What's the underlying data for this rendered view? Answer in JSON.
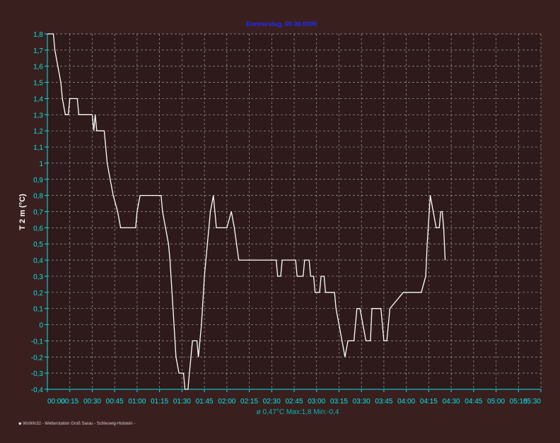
{
  "chart_data": {
    "type": "line",
    "title": "Donnerstag, 00.00.0000",
    "ylabel": "T 2 m (°C)",
    "xlabel": "",
    "ylim": [
      -0.4,
      1.8
    ],
    "grid": true,
    "x_ticks": [
      "00:00",
      "00:15",
      "00:30",
      "00:45",
      "01:00",
      "01:15",
      "01:30",
      "01:45",
      "02:00",
      "02:15",
      "02:30",
      "02:45",
      "03:00",
      "03:15",
      "03:30",
      "03:45",
      "04:00",
      "04:15",
      "04:30",
      "04:45",
      "05:00",
      "05:15",
      "05:30"
    ],
    "y_ticks": [
      "1,8",
      "1,7",
      "1,6",
      "1,5",
      "1,4",
      "1,3",
      "1,2",
      "1,1",
      "1",
      "0,9",
      "0,8",
      "0,7",
      "0,6",
      "0,5",
      "0,4",
      "0,3",
      "0,2",
      "0,1",
      "0",
      "-0,1",
      "-0,2",
      "-0,3",
      "-0,4"
    ],
    "series": [
      {
        "color": "#ffffff",
        "points": [
          [
            "00:00",
            1.8
          ],
          [
            "00:04",
            1.8
          ],
          [
            "00:05",
            1.7
          ],
          [
            "00:07",
            1.6
          ],
          [
            "00:09",
            1.5
          ],
          [
            "00:10",
            1.4
          ],
          [
            "00:12",
            1.3
          ],
          [
            "00:14",
            1.3
          ],
          [
            "00:15",
            1.4
          ],
          [
            "00:20",
            1.4
          ],
          [
            "00:21",
            1.3
          ],
          [
            "00:30",
            1.3
          ],
          [
            "00:31",
            1.2
          ],
          [
            "00:32",
            1.3
          ],
          [
            "00:33",
            1.2
          ],
          [
            "00:38",
            1.2
          ],
          [
            "00:39",
            1.1
          ],
          [
            "00:40",
            1.0
          ],
          [
            "00:42",
            0.9
          ],
          [
            "00:44",
            0.8
          ],
          [
            "00:47",
            0.7
          ],
          [
            "00:49",
            0.6
          ],
          [
            "00:59",
            0.6
          ],
          [
            "01:00",
            0.7
          ],
          [
            "01:02",
            0.8
          ],
          [
            "01:16",
            0.8
          ],
          [
            "01:17",
            0.7
          ],
          [
            "01:19",
            0.6
          ],
          [
            "01:21",
            0.5
          ],
          [
            "01:22",
            0.4
          ],
          [
            "01:24",
            0.1
          ],
          [
            "01:26",
            -0.2
          ],
          [
            "01:28",
            -0.3
          ],
          [
            "01:31",
            -0.3
          ],
          [
            "01:32",
            -0.4
          ],
          [
            "01:34",
            -0.4
          ],
          [
            "01:35",
            -0.3
          ],
          [
            "01:37",
            -0.1
          ],
          [
            "01:40",
            -0.1
          ],
          [
            "01:41",
            -0.2
          ],
          [
            "01:43",
            0.0
          ],
          [
            "01:45",
            0.3
          ],
          [
            "01:47",
            0.5
          ],
          [
            "01:49",
            0.7
          ],
          [
            "01:51",
            0.8
          ],
          [
            "01:53",
            0.6
          ],
          [
            "02:00",
            0.6
          ],
          [
            "02:03",
            0.7
          ],
          [
            "02:05",
            0.6
          ],
          [
            "02:08",
            0.4
          ],
          [
            "02:33",
            0.4
          ],
          [
            "02:34",
            0.3
          ],
          [
            "02:36",
            0.3
          ],
          [
            "02:37",
            0.4
          ],
          [
            "02:46",
            0.4
          ],
          [
            "02:47",
            0.3
          ],
          [
            "02:51",
            0.3
          ],
          [
            "02:52",
            0.4
          ],
          [
            "02:55",
            0.4
          ],
          [
            "02:56",
            0.3
          ],
          [
            "02:58",
            0.3
          ],
          [
            "02:59",
            0.2
          ],
          [
            "03:02",
            0.2
          ],
          [
            "03:03",
            0.3
          ],
          [
            "03:05",
            0.3
          ],
          [
            "03:06",
            0.2
          ],
          [
            "03:12",
            0.2
          ],
          [
            "03:13",
            0.1
          ],
          [
            "03:15",
            0.0
          ],
          [
            "03:17",
            -0.1
          ],
          [
            "03:19",
            -0.2
          ],
          [
            "03:21",
            -0.1
          ],
          [
            "03:25",
            -0.1
          ],
          [
            "03:27",
            0.1
          ],
          [
            "03:29",
            0.1
          ],
          [
            "03:31",
            0.0
          ],
          [
            "03:33",
            -0.1
          ],
          [
            "03:36",
            -0.1
          ],
          [
            "03:37",
            0.1
          ],
          [
            "03:43",
            0.1
          ],
          [
            "03:45",
            -0.1
          ],
          [
            "03:47",
            -0.1
          ],
          [
            "03:49",
            0.1
          ],
          [
            "03:58",
            0.2
          ],
          [
            "04:10",
            0.2
          ],
          [
            "04:13",
            0.3
          ],
          [
            "04:14",
            0.5
          ],
          [
            "04:16",
            0.8
          ],
          [
            "04:18",
            0.7
          ],
          [
            "04:20",
            0.6
          ],
          [
            "04:22",
            0.6
          ],
          [
            "04:23",
            0.7
          ],
          [
            "04:24",
            0.7
          ],
          [
            "04:25",
            0.6
          ],
          [
            "04:26",
            0.4
          ]
        ]
      }
    ],
    "stats": "ø 0,47°C  Max:1,8  Min:-0,4"
  },
  "footer": "◆ WsWin32 - Wetterstation Groß Sarau - Schleswig-Holstein -",
  "colors": {
    "background": "#3a1f1f",
    "plot_background": "#2e1a1a",
    "grid": "#9a9a9a",
    "axis_text": "#00e5e5",
    "title": "#1f2cff",
    "line": "#ffffff"
  }
}
